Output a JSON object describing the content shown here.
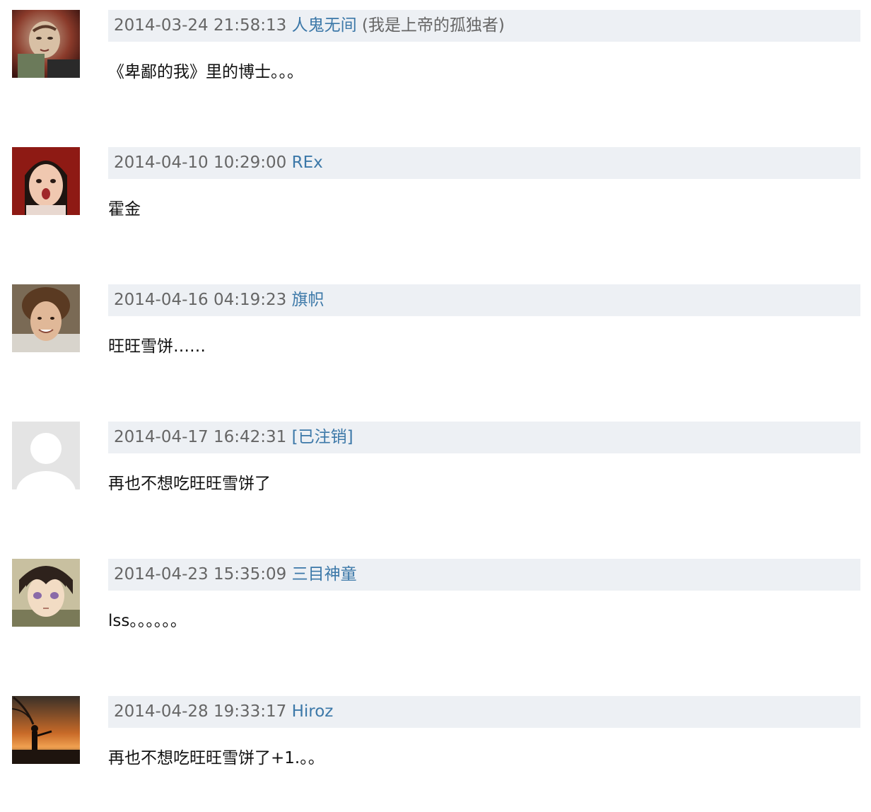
{
  "comments": [
    {
      "avatar_icon": "user-avatar-photo-man-red",
      "time": "2014-03-24 21:58:13",
      "author": "人鬼无间",
      "signature": "(我是上帝的孤独者)",
      "text": "《卑鄙的我》里的博士。。。"
    },
    {
      "avatar_icon": "user-avatar-photo-child",
      "time": "2014-04-10 10:29:00",
      "author": "REx",
      "signature": "",
      "text": "霍金"
    },
    {
      "avatar_icon": "user-avatar-photo-curly-man",
      "time": "2014-04-16 04:19:23",
      "author": "旗帜",
      "signature": "",
      "text": "旺旺雪饼……"
    },
    {
      "avatar_icon": "default-avatar-placeholder",
      "time": "2014-04-17 16:42:31",
      "author": "[已注销]",
      "signature": "",
      "text": "再也不想吃旺旺雪饼了"
    },
    {
      "avatar_icon": "user-avatar-anime-character",
      "time": "2014-04-23 15:35:09",
      "author": "三目神童",
      "signature": "",
      "text": "lss。。。。。。"
    },
    {
      "avatar_icon": "user-avatar-sunset-silhouette",
      "time": "2014-04-28 19:33:17",
      "author": "Hiroz",
      "signature": "",
      "text": "再也不想吃旺旺雪饼了+1.。。"
    }
  ],
  "colors": {
    "meta_background": "#edf0f4",
    "author_link": "#3c78a8",
    "timestamp": "#666666",
    "content_text": "#111111"
  }
}
